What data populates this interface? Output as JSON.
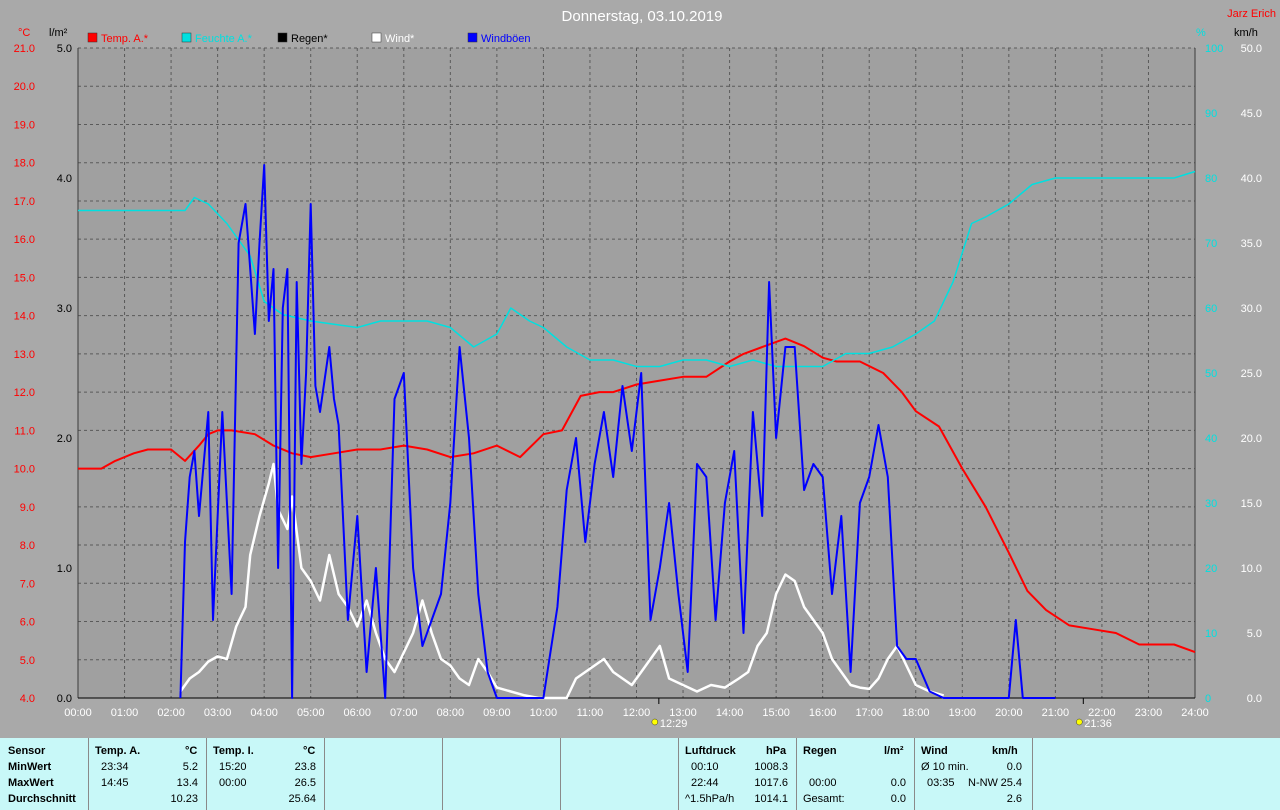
{
  "header": {
    "title": "Donnerstag, 03.10.2019",
    "author": "Jarz Erich",
    "unit_left_temp": "°C",
    "unit_left_rain": "l/m²",
    "unit_right_pressure": "%",
    "unit_right_wind": "km/h"
  },
  "colors": {
    "background": "#a9a9a9",
    "plot": "#a0a0a0",
    "temp": "#ff0000",
    "pressure": "#00e0e0",
    "rain": "#000000",
    "wind": "#ffffff",
    "gusts": "#0000ff",
    "summary_bg": "#c8f8f8"
  },
  "chart_data": {
    "type": "line",
    "x_unit": "hours",
    "xlim": [
      0,
      24
    ],
    "x_ticks": [
      "00:00",
      "01:00",
      "02:00",
      "03:00",
      "04:00",
      "05:00",
      "06:00",
      "07:00",
      "08:00",
      "09:00",
      "10:00",
      "11:00",
      "12:00",
      "13:00",
      "14:00",
      "15:00",
      "16:00",
      "17:00",
      "18:00",
      "19:00",
      "20:00",
      "21:00",
      "22:00",
      "23:00",
      "24:00"
    ],
    "axes": {
      "temp": {
        "label": "°C",
        "ylim": [
          4.0,
          21.0
        ],
        "ticks": [
          "4.0",
          "5.0",
          "6.0",
          "7.0",
          "8.0",
          "9.0",
          "10.0",
          "11.0",
          "12.0",
          "13.0",
          "14.0",
          "15.0",
          "16.0",
          "17.0",
          "18.0",
          "19.0",
          "20.0",
          "21.0"
        ]
      },
      "rain": {
        "label": "l/m²",
        "ylim": [
          0.0,
          5.0
        ],
        "ticks": [
          "0.0",
          "1.0",
          "2.0",
          "3.0",
          "4.0",
          "5.0"
        ]
      },
      "pressure": {
        "label": "%",
        "ylim": [
          0,
          100
        ],
        "ticks": [
          "0",
          "10",
          "20",
          "30",
          "40",
          "50",
          "60",
          "70",
          "80",
          "90",
          "100"
        ]
      },
      "wind": {
        "label": "km/h",
        "ylim": [
          0.0,
          50.0
        ],
        "ticks": [
          "0.0",
          "5.0",
          "10.0",
          "15.0",
          "20.0",
          "25.0",
          "30.0",
          "35.0",
          "40.0",
          "45.0",
          "50.0"
        ]
      }
    },
    "markers": [
      {
        "label": "12:29",
        "x": 12.48
      },
      {
        "label": "21:36",
        "x": 21.6
      }
    ],
    "legend": [
      {
        "name": "Temp. A.*",
        "color": "#ff0000"
      },
      {
        "name": "Feuchte A.*",
        "color": "#00e0e0"
      },
      {
        "name": "Regen*",
        "color": "#000000"
      },
      {
        "name": "Wind*",
        "color": "#ffffff"
      },
      {
        "name": "Windböen",
        "color": "#0000ff"
      }
    ],
    "grid": true,
    "series": [
      {
        "name": "Temp. A.*",
        "axis": "temp",
        "color": "#ff0000",
        "x": [
          0,
          0.5,
          0.8,
          1.2,
          1.5,
          2.0,
          2.3,
          2.6,
          2.8,
          3.0,
          3.3,
          3.8,
          4.2,
          4.6,
          5.0,
          5.5,
          6.0,
          6.5,
          7.0,
          7.5,
          8.0,
          8.5,
          9.0,
          9.5,
          10.0,
          10.4,
          10.8,
          11.2,
          11.5,
          12.0,
          12.5,
          13.0,
          13.5,
          14.0,
          14.3,
          14.75,
          15.2,
          15.6,
          16.0,
          16.3,
          16.8,
          17.3,
          17.7,
          18.0,
          18.5,
          19.0,
          19.5,
          20.0,
          20.4,
          20.8,
          21.3,
          21.8,
          22.3,
          22.8,
          23.3,
          23.55,
          24.0
        ],
        "y": [
          10.0,
          10.0,
          10.2,
          10.4,
          10.5,
          10.5,
          10.2,
          10.6,
          10.9,
          11.0,
          11.0,
          10.9,
          10.6,
          10.4,
          10.3,
          10.4,
          10.5,
          10.5,
          10.6,
          10.5,
          10.3,
          10.4,
          10.6,
          10.3,
          10.9,
          11.0,
          11.9,
          12.0,
          12.0,
          12.2,
          12.3,
          12.4,
          12.4,
          12.8,
          13.0,
          13.2,
          13.4,
          13.2,
          12.9,
          12.8,
          12.8,
          12.5,
          12.0,
          11.5,
          11.1,
          10.0,
          9.0,
          7.8,
          6.8,
          6.3,
          5.9,
          5.8,
          5.7,
          5.4,
          5.4,
          5.4,
          5.2
        ]
      },
      {
        "name": "Feuchte A.*",
        "axis": "pressure",
        "color": "#00e0e0",
        "x": [
          0,
          2.3,
          2.5,
          2.8,
          3.2,
          3.7,
          4.0,
          4.4,
          5.0,
          6.0,
          6.5,
          7.0,
          7.5,
          8.0,
          8.5,
          9.0,
          9.3,
          9.7,
          10.0,
          10.5,
          11.0,
          11.5,
          12.0,
          12.5,
          13.0,
          13.5,
          14.0,
          14.5,
          15.0,
          15.5,
          16.0,
          16.5,
          17.0,
          17.5,
          18.0,
          18.4,
          18.8,
          19.2,
          19.5,
          20.0,
          20.5,
          21.0,
          22.0,
          23.0,
          23.55,
          24.0
        ],
        "y": [
          75,
          75,
          77,
          76,
          73,
          68,
          61,
          59,
          58,
          57,
          58,
          58,
          58,
          57,
          54,
          56,
          60,
          58,
          57,
          54,
          52,
          52,
          51,
          51,
          52,
          52,
          51,
          52,
          51,
          51,
          51,
          53,
          53,
          54,
          56,
          58,
          64,
          73,
          74,
          76,
          79,
          80,
          80,
          80,
          80,
          81
        ]
      },
      {
        "name": "Regen*",
        "axis": "rain",
        "color": "#000000",
        "x": [
          0,
          24
        ],
        "y": [
          0.0,
          0.0
        ]
      },
      {
        "name": "Wind*",
        "axis": "wind",
        "color": "#ffffff",
        "x": [
          2.2,
          2.4,
          2.6,
          2.8,
          3.0,
          3.2,
          3.4,
          3.6,
          3.7,
          3.9,
          4.1,
          4.2,
          4.3,
          4.5,
          4.6,
          4.8,
          5.0,
          5.2,
          5.4,
          5.6,
          5.8,
          6.0,
          6.2,
          6.4,
          6.6,
          6.8,
          7.0,
          7.2,
          7.4,
          7.6,
          7.8,
          8.0,
          8.2,
          8.4,
          8.6,
          8.8,
          9.0,
          9.3,
          9.6,
          9.9,
          10.2,
          10.5,
          10.7,
          10.9,
          11.1,
          11.3,
          11.5,
          11.7,
          11.9,
          12.1,
          12.3,
          12.5,
          12.7,
          13.0,
          13.3,
          13.6,
          13.9,
          14.2,
          14.4,
          14.6,
          14.8,
          15.0,
          15.2,
          15.4,
          15.6,
          15.8,
          16.0,
          16.2,
          16.4,
          16.6,
          16.8,
          17.0,
          17.2,
          17.4,
          17.6,
          17.8,
          18.0,
          18.3,
          18.6
        ],
        "y": [
          0.5,
          1.5,
          2.0,
          2.8,
          3.2,
          3.0,
          5.5,
          7.0,
          11.0,
          14.0,
          16.5,
          18.0,
          14.5,
          13.0,
          15.5,
          10.0,
          9.0,
          7.5,
          11.0,
          8.0,
          7.0,
          5.5,
          7.5,
          5.0,
          3.0,
          2.0,
          3.5,
          5.0,
          7.5,
          5.0,
          3.0,
          2.5,
          1.5,
          1.0,
          3.0,
          2.0,
          0.8,
          0.5,
          0.2,
          0.0,
          0.0,
          0.0,
          1.5,
          2.0,
          2.5,
          3.0,
          2.0,
          1.5,
          1.0,
          2.0,
          3.0,
          4.0,
          1.5,
          1.0,
          0.5,
          1.0,
          0.8,
          1.5,
          2.0,
          4.0,
          5.0,
          8.0,
          9.5,
          9.0,
          7.0,
          6.0,
          5.0,
          3.0,
          2.0,
          1.0,
          0.8,
          0.7,
          1.5,
          3.0,
          4.0,
          2.5,
          1.0,
          0.5,
          0.2
        ]
      },
      {
        "name": "Windböen",
        "axis": "wind",
        "color": "#0000ff",
        "x": [
          2.2,
          2.3,
          2.4,
          2.5,
          2.6,
          2.8,
          2.9,
          3.1,
          3.3,
          3.45,
          3.6,
          3.8,
          3.9,
          4.0,
          4.1,
          4.2,
          4.3,
          4.4,
          4.5,
          4.6,
          4.7,
          4.8,
          4.9,
          5.0,
          5.1,
          5.2,
          5.4,
          5.5,
          5.6,
          5.8,
          6.0,
          6.2,
          6.4,
          6.6,
          6.8,
          7.0,
          7.2,
          7.4,
          7.6,
          7.8,
          8.0,
          8.2,
          8.4,
          8.6,
          8.8,
          9.0,
          9.3,
          9.6,
          10.0,
          10.3,
          10.5,
          10.7,
          10.9,
          11.1,
          11.3,
          11.5,
          11.7,
          11.9,
          12.1,
          12.3,
          12.5,
          12.7,
          12.9,
          13.1,
          13.3,
          13.5,
          13.7,
          13.9,
          14.1,
          14.3,
          14.5,
          14.7,
          14.85,
          15.0,
          15.2,
          15.4,
          15.6,
          15.8,
          16.0,
          16.2,
          16.4,
          16.6,
          16.8,
          17.0,
          17.2,
          17.4,
          17.6,
          17.8,
          18.0,
          18.3,
          18.6,
          19.0,
          20.0,
          20.15,
          20.3,
          21.0
        ],
        "y": [
          0.0,
          12.0,
          17.0,
          19.0,
          14.0,
          22.0,
          6.0,
          22.0,
          8.0,
          35.0,
          38.0,
          28.0,
          35.0,
          41.0,
          29.0,
          33.0,
          10.0,
          30.0,
          33.0,
          0.0,
          32.0,
          18.0,
          25.0,
          38.0,
          24.0,
          22.0,
          27.0,
          23.0,
          21.0,
          6.0,
          14.0,
          2.0,
          10.0,
          0.0,
          23.0,
          25.0,
          10.0,
          4.0,
          6.0,
          8.0,
          15.0,
          27.0,
          20.0,
          8.0,
          2.0,
          0.0,
          0.0,
          0.0,
          0.0,
          7.0,
          16.0,
          20.0,
          12.0,
          18.0,
          22.0,
          17.0,
          24.0,
          19.0,
          25.0,
          6.0,
          10.0,
          15.0,
          8.0,
          2.0,
          18.0,
          17.0,
          6.0,
          15.0,
          19.0,
          5.0,
          22.0,
          14.0,
          32.0,
          20.0,
          27.0,
          27.0,
          16.0,
          18.0,
          17.0,
          8.0,
          14.0,
          2.0,
          15.0,
          17.0,
          21.0,
          17.0,
          4.0,
          3.0,
          3.0,
          0.5,
          0.0,
          0.0,
          0.0,
          6.0,
          0.0,
          0.0
        ]
      }
    ]
  },
  "summary": {
    "sensor": {
      "title": "Sensor",
      "rows": [
        "MinWert",
        "MaxWert",
        "Durchschnitt"
      ]
    },
    "temp_a": {
      "title": "Temp. A.",
      "unit": "°C",
      "min_time": "23:34",
      "min_val": "5.2",
      "max_time": "14:45",
      "max_val": "13.4",
      "avg": "10.23"
    },
    "temp_i": {
      "title": "Temp. I.",
      "unit": "°C",
      "min_time": "15:20",
      "min_val": "23.8",
      "max_time": "00:00",
      "max_val": "26.5",
      "avg": "25.64"
    },
    "luftdruck": {
      "title": "Luftdruck",
      "unit": "hPa",
      "min_time": "00:10",
      "min_val": "1008.3",
      "max_time": "22:44",
      "max_val": "1017.6",
      "trend_label": "^1.5hPa/h",
      "trend_val": "1014.1"
    },
    "regen": {
      "title": "Regen",
      "unit": "l/m²",
      "max_time": "00:00",
      "max_val": "0.0",
      "total_label": "Gesamt:",
      "total_val": "0.0"
    },
    "wind": {
      "title": "Wind",
      "unit": "km/h",
      "avg_label": "Ø 10 min.",
      "avg_val": "0.0",
      "max_time": "03:35",
      "max_dir": "N-NW",
      "max_val": "25.4",
      "mean_val": "2.6"
    }
  }
}
